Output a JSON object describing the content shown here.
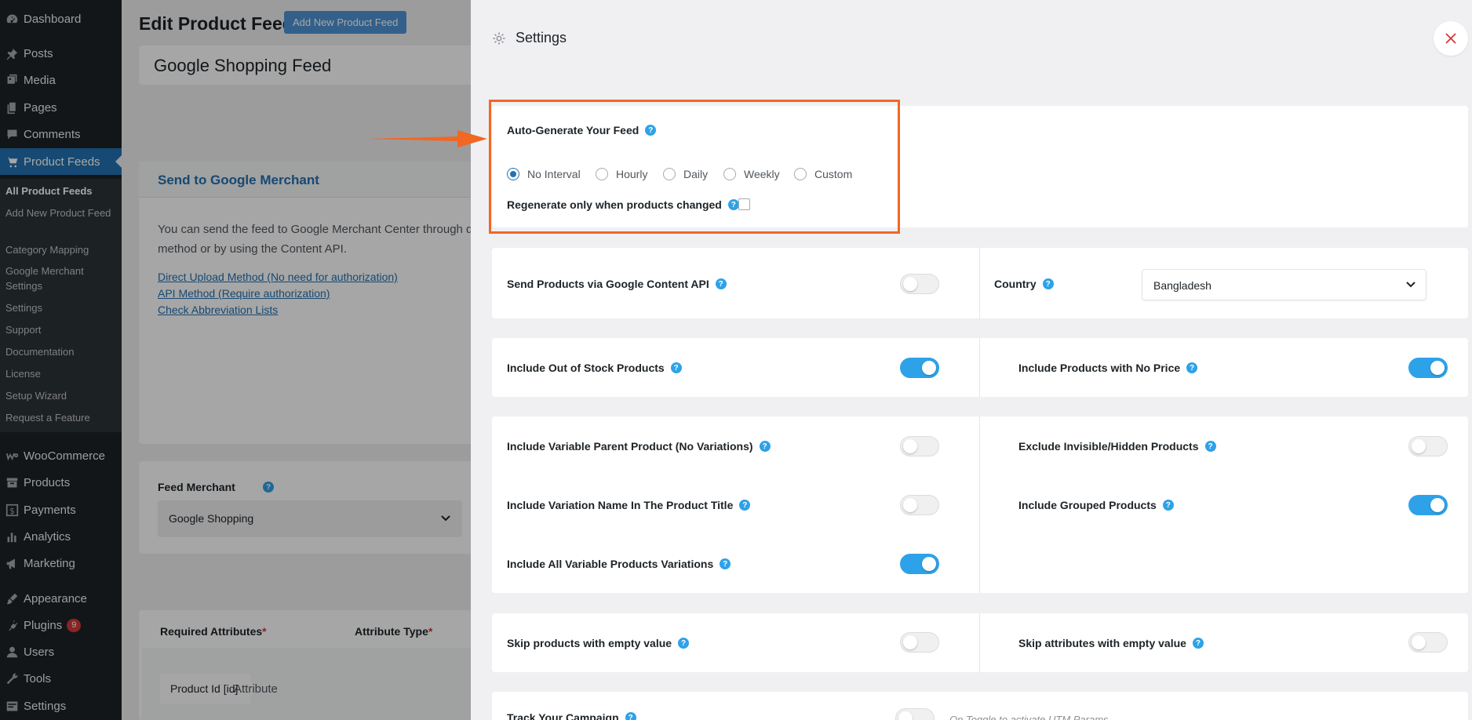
{
  "sidebar": {
    "items": [
      {
        "label": "Dashboard",
        "icon": "dashboard-icon"
      },
      {
        "label": "Posts",
        "icon": "pin-icon"
      },
      {
        "label": "Media",
        "icon": "media-icon"
      },
      {
        "label": "Pages",
        "icon": "pages-icon"
      },
      {
        "label": "Comments",
        "icon": "comment-icon"
      },
      {
        "label": "Product Feeds",
        "icon": "cart-icon",
        "active": true
      },
      {
        "label": "WooCommerce",
        "icon": "woo-icon"
      },
      {
        "label": "Products",
        "icon": "archive-icon"
      },
      {
        "label": "Payments",
        "icon": "dollar-icon"
      },
      {
        "label": "Analytics",
        "icon": "bar-chart-icon"
      },
      {
        "label": "Marketing",
        "icon": "megaphone-icon"
      },
      {
        "label": "Appearance",
        "icon": "brush-icon"
      },
      {
        "label": "Plugins",
        "icon": "plug-icon",
        "badge": "9"
      },
      {
        "label": "Users",
        "icon": "user-icon"
      },
      {
        "label": "Tools",
        "icon": "wrench-icon"
      },
      {
        "label": "Settings",
        "icon": "settings-icon"
      }
    ],
    "submenu": [
      "All Product Feeds",
      "Add New Product Feed",
      "Category Mapping",
      "Google Merchant Settings",
      "Settings",
      "Support",
      "Documentation",
      "License",
      "Setup Wizard",
      "Request a Feature"
    ]
  },
  "page": {
    "title": "Edit Product Feed",
    "add_new_label": "Add New Product Feed",
    "feed_name": "Google Shopping Feed",
    "google_merchant": {
      "heading": "Send to Google Merchant",
      "description": "You can send the feed to Google Merchant Center through d upload method or by using the Content API.",
      "links": [
        "Direct Upload Method (No need for authorization)",
        "API Method (Require authorization)",
        "Check Abbreviation Lists"
      ]
    },
    "feed_merchant": {
      "label": "Feed Merchant",
      "value": "Google Shopping"
    },
    "attributes": {
      "col_required": "Required Attributes",
      "col_type": "Attribute Type",
      "required_mark": "*",
      "row_name": "Product Id [id]",
      "row_type": "Attribute"
    }
  },
  "settings": {
    "title": "Settings",
    "auto_generate": {
      "label": "Auto-Generate Your Feed",
      "options": [
        "No Interval",
        "Hourly",
        "Daily",
        "Weekly",
        "Custom"
      ],
      "selected": "No Interval",
      "regenerate_label": "Regenerate only when products changed",
      "regenerate_checked": false
    },
    "content_api": {
      "label": "Send Products via Google Content API",
      "enabled": false,
      "country_label": "Country",
      "country_value": "Bangladesh"
    },
    "toggles": {
      "out_of_stock": {
        "label": "Include Out of Stock Products",
        "on": true
      },
      "no_price": {
        "label": "Include Products with No Price",
        "on": true
      },
      "variable_parent": {
        "label": "Include Variable Parent Product (No Variations)",
        "on": false
      },
      "invisible": {
        "label": "Exclude Invisible/Hidden Products",
        "on": false
      },
      "variation_name": {
        "label": "Include Variation Name In The Product Title",
        "on": false
      },
      "grouped": {
        "label": "Include Grouped Products",
        "on": true
      },
      "all_variations": {
        "label": "Include All Variable Products Variations",
        "on": true
      },
      "skip_products": {
        "label": "Skip products with empty value",
        "on": false
      },
      "skip_attributes": {
        "label": "Skip attributes with empty value",
        "on": false
      },
      "track_campaign": {
        "label": "Track Your Campaign",
        "on": false
      }
    },
    "track_hint": "On Toggle to activate UTM Params"
  },
  "colors": {
    "accent": "#2271b1",
    "toggle_on": "#2ea2e8",
    "annotation": "#f26722",
    "close": "#d63638"
  }
}
